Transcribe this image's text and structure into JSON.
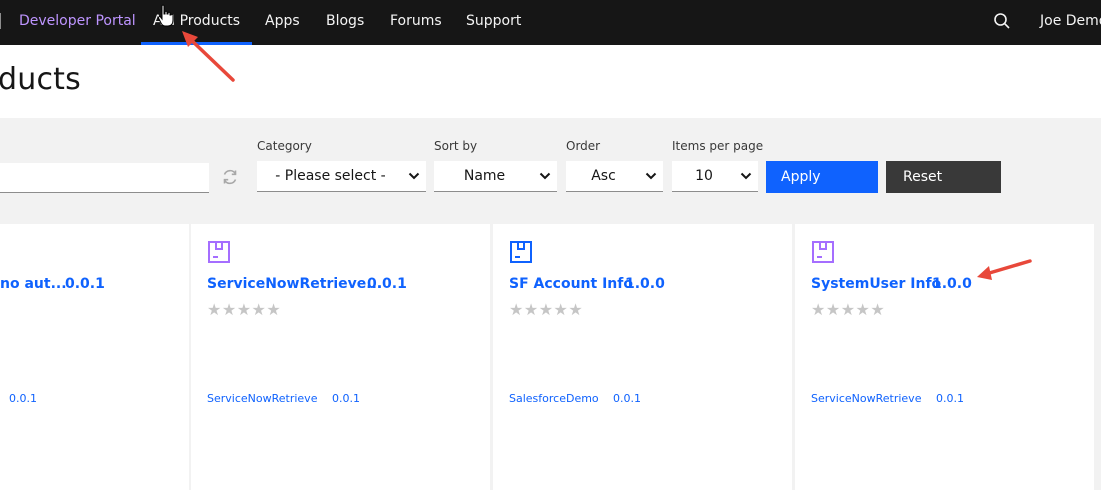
{
  "nav": {
    "brand": "Developer Portal",
    "items": [
      {
        "label": "API Products",
        "active": true
      },
      {
        "label": "Apps"
      },
      {
        "label": "Blogs"
      },
      {
        "label": "Forums"
      },
      {
        "label": "Support"
      }
    ],
    "user": "Joe Demo",
    "search_icon": "search-icon"
  },
  "page": {
    "title": "ducts"
  },
  "filters": {
    "category": {
      "label": "Category",
      "value": "- Please select -"
    },
    "sort_by": {
      "label": "Sort by",
      "value": "Name"
    },
    "order": {
      "label": "Order",
      "value": "Asc"
    },
    "items_per_page": {
      "label": "Items per page",
      "value": "10"
    },
    "apply_label": "Apply",
    "reset_label": "Reset"
  },
  "cards": [
    {
      "title": "no aut...",
      "version": "0.0.1",
      "api": "",
      "api_version": "0.0.1",
      "rating": 0
    },
    {
      "title": "ServiceNowRetrieve...",
      "version": "0.0.1",
      "api": "ServiceNowRetrieve",
      "api_version": "0.0.1",
      "rating": 0
    },
    {
      "title": "SF Account Info",
      "version": "1.0.0",
      "api": "SalesforceDemo",
      "api_version": "0.0.1",
      "rating": 0
    },
    {
      "title": "SystemUser Info",
      "version": "1.0.0",
      "api": "ServiceNowRetrieve",
      "api_version": "0.0.1",
      "rating": 0
    }
  ],
  "colors": {
    "nav_bg": "#161616",
    "brand": "#be95ff",
    "accent": "#0f62fe",
    "product_icon_purple": "#a56eff",
    "product_icon_blue": "#0f62fe",
    "annotation_arrow": "#e8483a"
  },
  "stars_glyph": "★★★★★"
}
